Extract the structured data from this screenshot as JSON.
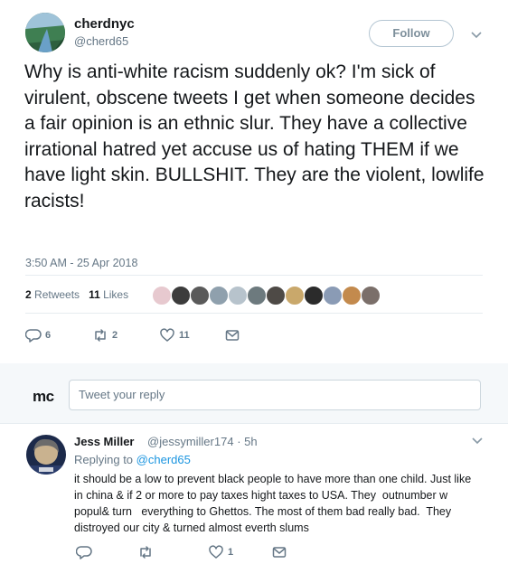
{
  "tweet": {
    "author_name": "cherdnyc",
    "author_handle": "@cherd65",
    "follow_label": "Follow",
    "text": "Why is anti-white racism suddenly ok? I'm sick of  virulent, obscene tweets I get when someone decides a fair opinion is an ethnic slur. They have a collective irrational hatred yet accuse us of hating THEM if we have light skin. BULLSHIT. They are the violent, lowlife racists!",
    "timestamp": "3:50 AM - 25 Apr 2018",
    "retweets_count": "2",
    "retweets_label": "Retweets",
    "likes_count": "11",
    "likes_label": "Likes",
    "liker_avatar_colors": [
      "#e7c9cf",
      "#3c3c3c",
      "#5a5a5a",
      "#8fa0ad",
      "#b7c3cc",
      "#6d7a7e",
      "#4e4a46",
      "#c9a86b",
      "#2b2b2b",
      "#8a9bb5",
      "#c38a4d",
      "#7b6f6a"
    ],
    "actions": {
      "reply_count": "6",
      "retweet_count": "2",
      "like_count": "11"
    },
    "colors": {
      "icon": "#657786",
      "link": "#1b95e0"
    }
  },
  "reply_bar": {
    "logo_text": "mc",
    "placeholder": "Tweet your reply"
  },
  "reply": {
    "author_name": "Jess Miller",
    "author_handle": "@jessymiller174",
    "time": "· 5h",
    "replying_prefix": "Replying to",
    "replying_to": "@cherd65",
    "text": "it should be a low to prevent black people to have more than one child. Just like in china & if 2 or more to pay taxes hight taxes to USA. They  outnumber w popul& turn   everything to Ghettos. The most of them bad really bad.  They distroyed our city & turned almost everth slums",
    "actions": {
      "reply_count": "",
      "retweet_count": "",
      "like_count": "1"
    }
  }
}
